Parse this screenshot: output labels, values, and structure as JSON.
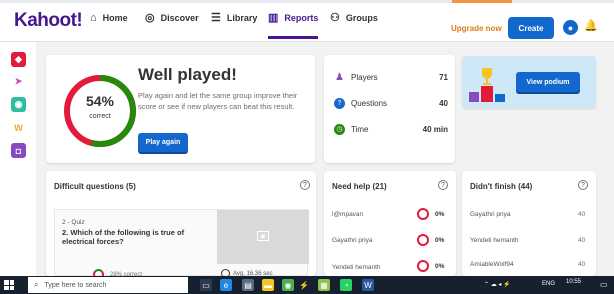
{
  "nav": {
    "logo": "Kahoot!",
    "items": [
      {
        "label": "Home",
        "icon": "home-icon",
        "glyph": "⌂"
      },
      {
        "label": "Discover",
        "icon": "compass-icon",
        "glyph": "◎"
      },
      {
        "label": "Library",
        "icon": "list-icon",
        "glyph": "☰"
      },
      {
        "label": "Reports",
        "icon": "reports-icon",
        "glyph": "▥"
      },
      {
        "label": "Groups",
        "icon": "groups-icon",
        "glyph": "⚇"
      }
    ],
    "upgrade": "Upgrade now",
    "create": "Create",
    "avatar_glyph": "●",
    "bell_glyph": "🔔"
  },
  "rail": {
    "icons": [
      {
        "name": "kahoot-app-icon",
        "glyph": "◆",
        "color": "#e21b3c"
      },
      {
        "name": "dragonbox-app-icon",
        "glyph": "➤",
        "color": "#c64fae"
      },
      {
        "name": "drops-app-icon",
        "glyph": "◉",
        "color": "#2fbfa0"
      },
      {
        "name": "poio-app-icon",
        "glyph": "W",
        "color": "#f3a33c"
      },
      {
        "name": "actimo-app-icon",
        "glyph": "◘",
        "color": "#864cbf"
      }
    ]
  },
  "hero": {
    "percent": "54%",
    "percent_label": "correct",
    "correct_fraction": 0.54,
    "title": "Well played!",
    "text": "Play again and let the same group improve their score or see if new players can beat this result.",
    "button": "Play again"
  },
  "stats": {
    "rows": [
      {
        "label": "Players",
        "value": "71",
        "icon": "player-icon",
        "color": "#864cbf",
        "glyph": "♟"
      },
      {
        "label": "Questions",
        "value": "40",
        "icon": "question-icon",
        "color": "#1368ce",
        "glyph": "?"
      },
      {
        "label": "Time",
        "value": "40 min",
        "icon": "time-icon",
        "color": "#26890c",
        "glyph": "◷"
      }
    ]
  },
  "podium": {
    "button": "View podium"
  },
  "difficult": {
    "title": "Difficult questions (5)",
    "help_glyph": "?",
    "question": {
      "type": "2 - Quiz",
      "text": "2. Which of the following is true of electrical forces?",
      "correct": "28% correct",
      "time": "Avg. 16.36 sec"
    }
  },
  "needhelp": {
    "title": "Need help (21)",
    "help_glyph": "?",
    "players": [
      {
        "name": "l@mpavan",
        "value": "0%"
      },
      {
        "name": "Gayathri priya",
        "value": "0%"
      },
      {
        "name": "Yendeti hemanth",
        "value": "0%"
      }
    ]
  },
  "didnt": {
    "title": "Didn't finish (44)",
    "help_glyph": "?",
    "players": [
      {
        "name": "Gayathri priya",
        "value": "40"
      },
      {
        "name": "Yendeti hemanth",
        "value": "40"
      },
      {
        "name": "AmiableWolf94",
        "value": "40"
      }
    ]
  },
  "taskbar": {
    "search_placeholder": "Type here to search",
    "eng": "ENG",
    "time": "10:55"
  },
  "colors": {
    "brand": "#46178f",
    "primary": "#1368ce",
    "green": "#26890c",
    "red": "#e21b3c",
    "orange": "#e07b15"
  }
}
